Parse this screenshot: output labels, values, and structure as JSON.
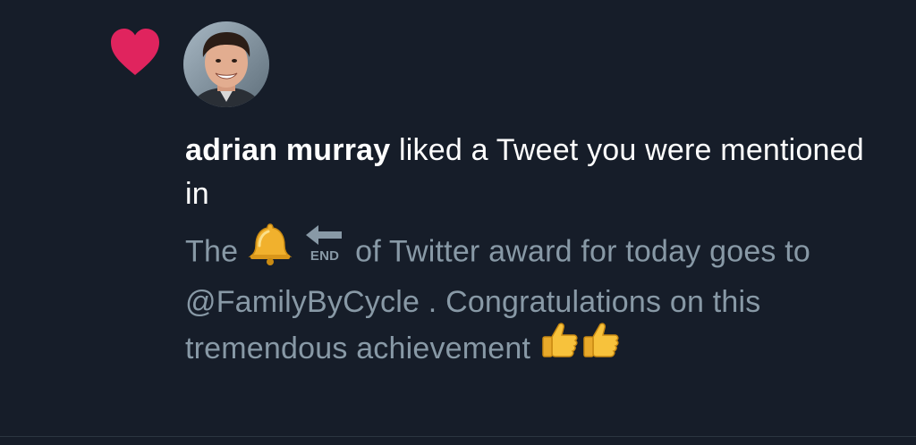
{
  "notification": {
    "action_icon": "heart-icon",
    "avatar": "user-avatar-photo",
    "user_name": "adrian murray",
    "action_text": " liked a Tweet you were mentioned in",
    "tweet": {
      "part1": "The ",
      "emoji1": "bell-emoji",
      "emoji2": "end-arrow-emoji",
      "part2": " of Twitter award for today goes to ",
      "mention": "@FamilyByCycle",
      "part3": " . Congratulations on this tremendous achievement ",
      "emoji3": "thumbs-up-emoji",
      "emoji4": "thumbs-up-emoji"
    }
  },
  "colors": {
    "background": "#161d29",
    "heart": "#e0245e",
    "primary_text": "#ffffff",
    "secondary_text": "#8899a6"
  }
}
